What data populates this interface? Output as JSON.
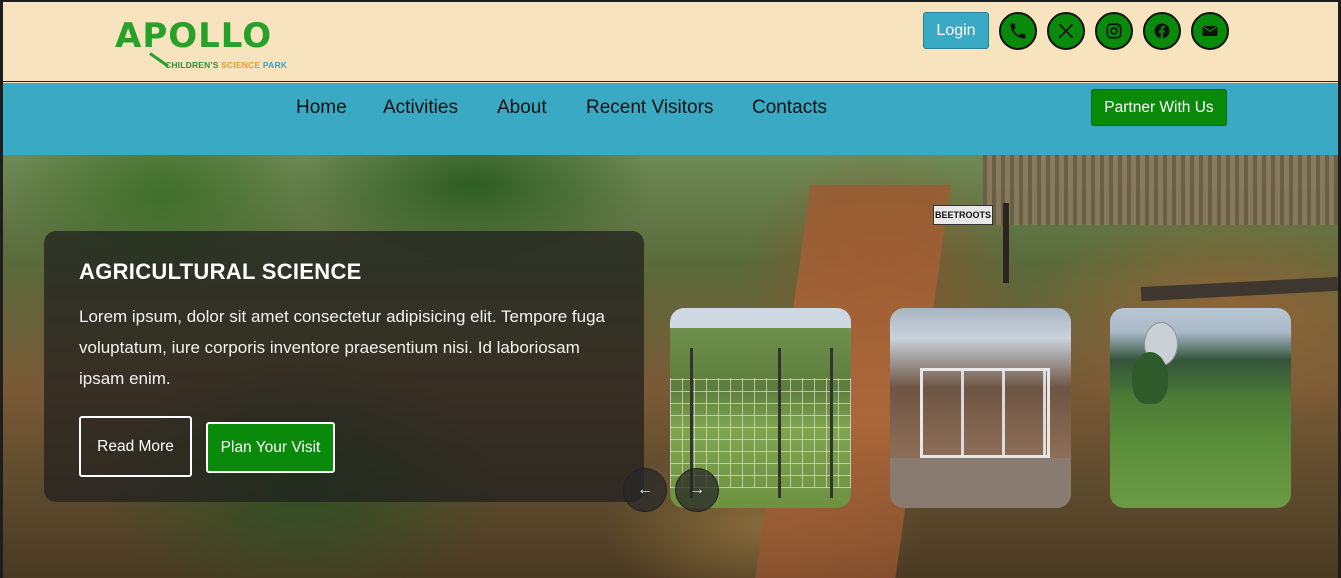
{
  "brand": {
    "logo_text": "APOLLO",
    "tagline_part1": "CHILDREN'S",
    "tagline_part2": "SCIENCE",
    "tagline_part3": "PARK",
    "logo_color": "#27a12a"
  },
  "header": {
    "login_label": "Login",
    "social_icons": [
      "phone-icon",
      "x-twitter-icon",
      "instagram-icon",
      "facebook-icon",
      "email-icon"
    ],
    "social_color": "#0a8a0a"
  },
  "nav": {
    "items": [
      "Home",
      "Activities",
      "About",
      "Recent Visitors",
      "Contacts"
    ],
    "partner_label": "Partner With Us",
    "bar_color": "#3aa9c4"
  },
  "hero": {
    "title": "AGRICULTURAL SCIENCE",
    "text": "Lorem ipsum, dolor sit amet consectetur adipisicing elit. Tempore fuga voluptatum, iure corporis inventore praesentium nisi. Id laboriosam ipsam enim.",
    "read_more_label": "Read More",
    "plan_visit_label": "Plan Your Visit",
    "sign_text": "BEETROOTS",
    "prev_icon": "←",
    "next_icon": "→"
  }
}
